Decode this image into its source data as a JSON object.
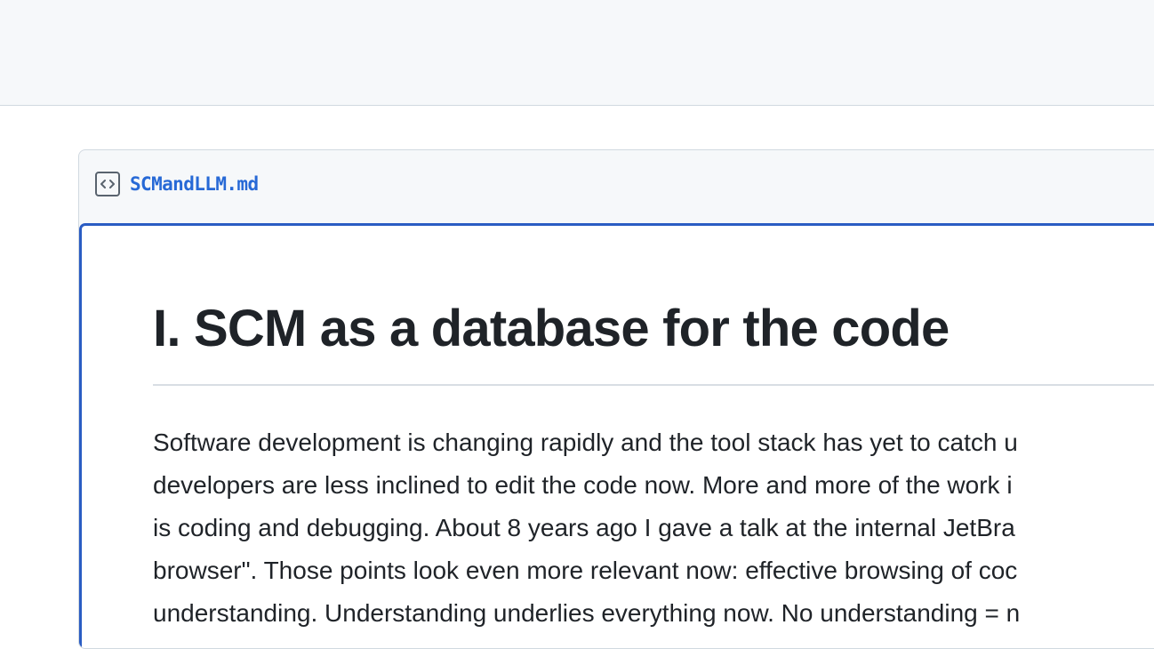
{
  "file": {
    "name": "SCMandLLM.md",
    "icon": "file-code-icon"
  },
  "document": {
    "title": "I. SCM as a database for the code",
    "paragraph_lines": [
      "Software development is changing rapidly and the tool stack has yet to catch u",
      "developers are less inclined to edit the code now. More and more of the work i",
      "is coding and debugging. About 8 years ago I gave a talk at the internal JetBra",
      "browser\". Those points look even more relevant now: effective browsing of coc",
      "understanding. Understanding underlies everything now. No understanding = n"
    ]
  },
  "colors": {
    "link": "#2769d6",
    "focus_border": "#2a5cc3",
    "header_bg": "#f6f8fa"
  }
}
